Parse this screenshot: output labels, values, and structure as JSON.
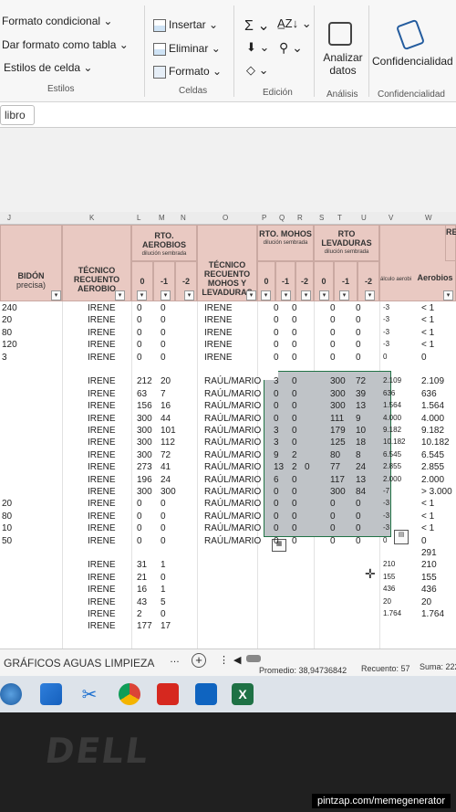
{
  "ribbon": {
    "formato_condicional": "Formato condicional",
    "dar_formato_tabla": "Dar formato como tabla",
    "estilos_celda": "Estilos de celda",
    "group_estilos": "Estilos",
    "insertar": "Insertar",
    "eliminar": "Eliminar",
    "formato": "Formato",
    "group_celdas": "Celdas",
    "group_edicion": "Edición",
    "analizar_datos": "Analizar datos",
    "group_analisis": "Análisis",
    "confidencialidad": "Confidencialidad",
    "group_confidencialidad": "Confidencialidad"
  },
  "formula_bar": {
    "name_box": "libro"
  },
  "columns": [
    "J",
    "K",
    "L",
    "M",
    "N",
    "O",
    "P",
    "Q",
    "R",
    "S",
    "T",
    "U",
    "V",
    "W"
  ],
  "headers": {
    "bidon": "BIDÓN",
    "precisa": "precisa)",
    "tecnico_recuento": "TÉCNICO RECUENTO AEROBIO",
    "rto_aerobios": "RTO. AEROBIOS",
    "dil_1": "dilución sembrada",
    "tecnico_mohos": "TÉCNICO RECUENTO MOHOS Y LEVADURAS",
    "rto_mohos": "RTO. MOHOS",
    "dil_2": "dilución sembrada",
    "rto_levaduras": "RTO LEVADURAS",
    "dil_3": "dilución sembrada",
    "calc_aerobios": "álculo aerobi",
    "aerobios": "Aerobios",
    "re": "RE",
    "d0": "0",
    "dm1": "-1",
    "dm2": "-2"
  },
  "rows": [
    {
      "j": "240",
      "k": "IRENE",
      "l": "0",
      "m": "0",
      "o": "IRENE",
      "p": "0",
      "q": "0",
      "s": "0",
      "t": "0",
      "v": "-3",
      "w": "< 1"
    },
    {
      "j": "20",
      "k": "IRENE",
      "l": "0",
      "m": "0",
      "o": "IRENE",
      "p": "0",
      "q": "0",
      "s": "0",
      "t": "0",
      "v": "-3",
      "w": "< 1"
    },
    {
      "j": "80",
      "k": "IRENE",
      "l": "0",
      "m": "0",
      "o": "IRENE",
      "p": "0",
      "q": "0",
      "s": "0",
      "t": "0",
      "v": "-3",
      "w": "< 1"
    },
    {
      "j": "120",
      "k": "IRENE",
      "l": "0",
      "m": "0",
      "o": "IRENE",
      "p": "0",
      "q": "0",
      "s": "0",
      "t": "0",
      "v": "-3",
      "w": "< 1"
    },
    {
      "j": "3",
      "k": "IRENE",
      "l": "0",
      "m": "0",
      "o": "IRENE",
      "p": "0",
      "q": "0",
      "s": "0",
      "t": "0",
      "v": "0",
      "w": "0"
    },
    {
      "j": "",
      "k": "",
      "l": "",
      "m": "",
      "o": "",
      "p": "",
      "q": "",
      "s": "",
      "t": "",
      "v": "",
      "w": ""
    },
    {
      "j": "",
      "k": "IRENE",
      "l": "212",
      "m": "20",
      "o": "RAÚL/MARIO",
      "p": "3",
      "q": "0",
      "s": "300",
      "t": "72",
      "v": "2.109",
      "w": "2.109"
    },
    {
      "j": "",
      "k": "IRENE",
      "l": "63",
      "m": "7",
      "o": "RAÚL/MARIO",
      "p": "0",
      "q": "0",
      "s": "300",
      "t": "39",
      "v": "636",
      "w": "636"
    },
    {
      "j": "",
      "k": "IRENE",
      "l": "156",
      "m": "16",
      "o": "RAÚL/MARIO",
      "p": "0",
      "q": "0",
      "s": "300",
      "t": "13",
      "v": "1.564",
      "w": "1.564"
    },
    {
      "j": "",
      "k": "IRENE",
      "l": "300",
      "m": "44",
      "o": "RAÚL/MARIO",
      "p": "0",
      "q": "0",
      "s": "111",
      "t": "9",
      "v": "4.000",
      "w": "4.000"
    },
    {
      "j": "",
      "k": "IRENE",
      "l": "300",
      "m": "101",
      "o": "RAÚL/MARIO",
      "p": "3",
      "q": "0",
      "s": "179",
      "t": "10",
      "v": "9.182",
      "w": "9.182"
    },
    {
      "j": "",
      "k": "IRENE",
      "l": "300",
      "m": "112",
      "o": "RAÚL/MARIO",
      "p": "3",
      "q": "0",
      "s": "125",
      "t": "18",
      "v": "10.182",
      "w": "10.182"
    },
    {
      "j": "",
      "k": "IRENE",
      "l": "300",
      "m": "72",
      "o": "RAÚL/MARIO",
      "p": "9",
      "q": "2",
      "s": "80",
      "t": "8",
      "v": "6.545",
      "w": "6.545"
    },
    {
      "j": "",
      "k": "IRENE",
      "l": "273",
      "m": "41",
      "o": "RAÚL/MARIO",
      "p": "13",
      "q": "2",
      "r": "0",
      "s": "77",
      "t": "24",
      "v": "2.855",
      "w": "2.855"
    },
    {
      "j": "",
      "k": "IRENE",
      "l": "196",
      "m": "24",
      "o": "RAÚL/MARIO",
      "p": "6",
      "q": "0",
      "s": "117",
      "t": "13",
      "v": "2.000",
      "w": "2.000"
    },
    {
      "j": "",
      "k": "IRENE",
      "l": "300",
      "m": "300",
      "o": "RAÚL/MARIO",
      "p": "0",
      "q": "0",
      "s": "300",
      "t": "84",
      "v": "-7",
      "w": "> 3.000"
    },
    {
      "j": "20",
      "k": "IRENE",
      "l": "0",
      "m": "0",
      "o": "RAÚL/MARIO",
      "p": "0",
      "q": "0",
      "s": "0",
      "t": "0",
      "v": "-3",
      "w": "< 1"
    },
    {
      "j": "80",
      "k": "IRENE",
      "l": "0",
      "m": "0",
      "o": "RAÚL/MARIO",
      "p": "0",
      "q": "0",
      "s": "0",
      "t": "0",
      "v": "-3",
      "w": "< 1"
    },
    {
      "j": "10",
      "k": "IRENE",
      "l": "0",
      "m": "0",
      "o": "RAÚL/MARIO",
      "p": "0",
      "q": "0",
      "s": "0",
      "t": "0",
      "v": "-3",
      "w": "< 1"
    },
    {
      "j": "50",
      "k": "IRENE",
      "l": "0",
      "m": "0",
      "o": "RAÚL/MARIO",
      "p": "0",
      "q": "0",
      "s": "0",
      "t": "0",
      "v": "0",
      "w": "0"
    },
    {
      "j": "",
      "k": "",
      "l": "",
      "m": "",
      "o": "",
      "p": "",
      "q": "",
      "s": "",
      "t": "",
      "v": "",
      "w": "291"
    },
    {
      "j": "",
      "k": "IRENE",
      "l": "31",
      "m": "1",
      "o": "",
      "p": "",
      "q": "",
      "s": "",
      "t": "",
      "v": "210",
      "w": "210"
    },
    {
      "j": "",
      "k": "IRENE",
      "l": "21",
      "m": "0",
      "o": "",
      "p": "",
      "q": "",
      "s": "",
      "t": "",
      "v": "155",
      "w": "155"
    },
    {
      "j": "",
      "k": "IRENE",
      "l": "16",
      "m": "1",
      "o": "",
      "p": "",
      "q": "",
      "s": "",
      "t": "",
      "v": "436",
      "w": "436"
    },
    {
      "j": "",
      "k": "IRENE",
      "l": "43",
      "m": "5",
      "o": "",
      "p": "",
      "q": "",
      "s": "",
      "t": "",
      "v": "20",
      "w": "20"
    },
    {
      "j": "",
      "k": "IRENE",
      "l": "2",
      "m": "0",
      "o": "",
      "p": "",
      "q": "",
      "s": "",
      "t": "",
      "v": "1.764",
      "w": "1.764"
    },
    {
      "j": "",
      "k": "IRENE",
      "l": "177",
      "m": "17",
      "o": "",
      "p": "",
      "q": "",
      "s": "",
      "t": "",
      "v": "",
      "w": ""
    }
  ],
  "sheet_tab": "GRÁFICOS AGUAS LIMPIEZA",
  "status": {
    "promedio": "Promedio: 38,94736842",
    "recuento": "Recuento: 57",
    "suma": "Suma: 222"
  },
  "taskbar_icons": [
    "widgets-icon",
    "start-icon",
    "snipping-tool-icon",
    "chrome-icon",
    "acrobat-icon",
    "outlook-icon",
    "excel-icon"
  ],
  "bezel_logo": "DELL",
  "watermark": "pintzap.com/memegenerator"
}
